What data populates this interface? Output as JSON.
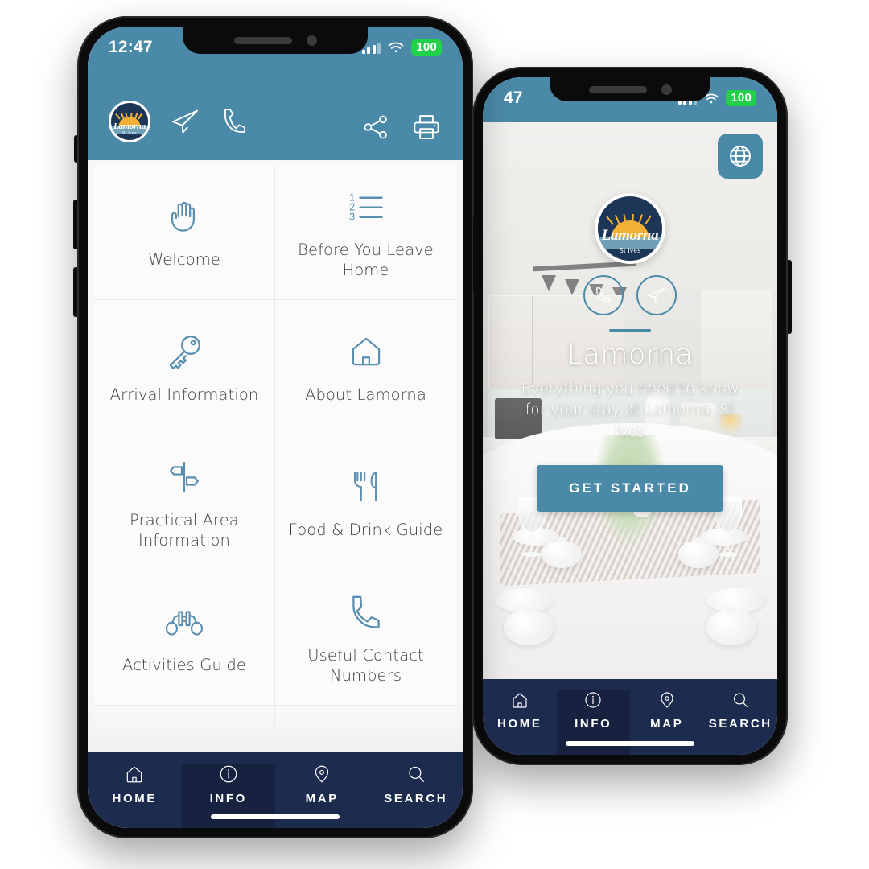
{
  "status_bar": {
    "time": "12:47",
    "battery": "100",
    "signal_icon": "cellular-bars-icon",
    "wifi_icon": "wifi-icon"
  },
  "back_phone": {
    "status_bar": {
      "time": "47",
      "battery": "100"
    },
    "language_button": {
      "icon": "globe-icon",
      "label": ""
    },
    "logo": {
      "word": "Lamorna",
      "sub": "St Ives"
    },
    "actions": [
      {
        "icon": "phone-icon",
        "name": "call-button"
      },
      {
        "icon": "paper-plane-icon",
        "name": "message-button"
      }
    ],
    "title": "Lamorna",
    "subtitle": "Everything you need to know for your stay at Lamorna, St Ives",
    "cta_label": "GET STARTED",
    "tabs": [
      {
        "label": "HOME",
        "icon": "home-icon",
        "active": false
      },
      {
        "label": "INFO",
        "icon": "info-icon",
        "active": true
      },
      {
        "label": "MAP",
        "icon": "map-pin-icon",
        "active": false
      },
      {
        "label": "SEARCH",
        "icon": "search-icon",
        "active": false
      }
    ]
  },
  "front_phone": {
    "header": {
      "logo": {
        "word": "Lamorna",
        "sub": "St Ives"
      },
      "left_icons": [
        {
          "icon": "paper-plane-icon",
          "name": "send-button"
        },
        {
          "icon": "phone-icon",
          "name": "call-button"
        }
      ],
      "right_icons": [
        {
          "icon": "share-icon",
          "name": "share-button"
        },
        {
          "icon": "printer-icon",
          "name": "print-button"
        }
      ]
    },
    "menu": [
      {
        "label": "Welcome",
        "icon": "hand-wave-icon"
      },
      {
        "label": "Before You Leave Home",
        "icon": "numbered-list-icon"
      },
      {
        "label": "Arrival Information",
        "icon": "key-icon"
      },
      {
        "label": "About Lamorna",
        "icon": "house-icon"
      },
      {
        "label": "Practical Area Information",
        "icon": "signpost-icon"
      },
      {
        "label": "Food & Drink Guide",
        "icon": "fork-knife-icon"
      },
      {
        "label": "Activities Guide",
        "icon": "binoculars-icon"
      },
      {
        "label": "Useful Contact Numbers",
        "icon": "phone-icon"
      },
      {
        "label": "",
        "icon": "open-book-icon"
      },
      {
        "label": "",
        "icon": "suitcase-icon"
      }
    ],
    "tabs": [
      {
        "label": "HOME",
        "icon": "home-icon",
        "active": false
      },
      {
        "label": "INFO",
        "icon": "info-icon",
        "active": true
      },
      {
        "label": "MAP",
        "icon": "map-pin-icon",
        "active": false
      },
      {
        "label": "SEARCH",
        "icon": "search-icon",
        "active": false
      }
    ]
  },
  "colors": {
    "teal": "#4a8aa8",
    "navy": "#1d2b4f",
    "navy_active": "#16223f",
    "icon_blue": "#5a8fb0",
    "label_gray": "#3c3c3c",
    "battery_green": "#20d14a",
    "logo_navy": "#1d3557",
    "logo_sun": "#f2b134"
  }
}
